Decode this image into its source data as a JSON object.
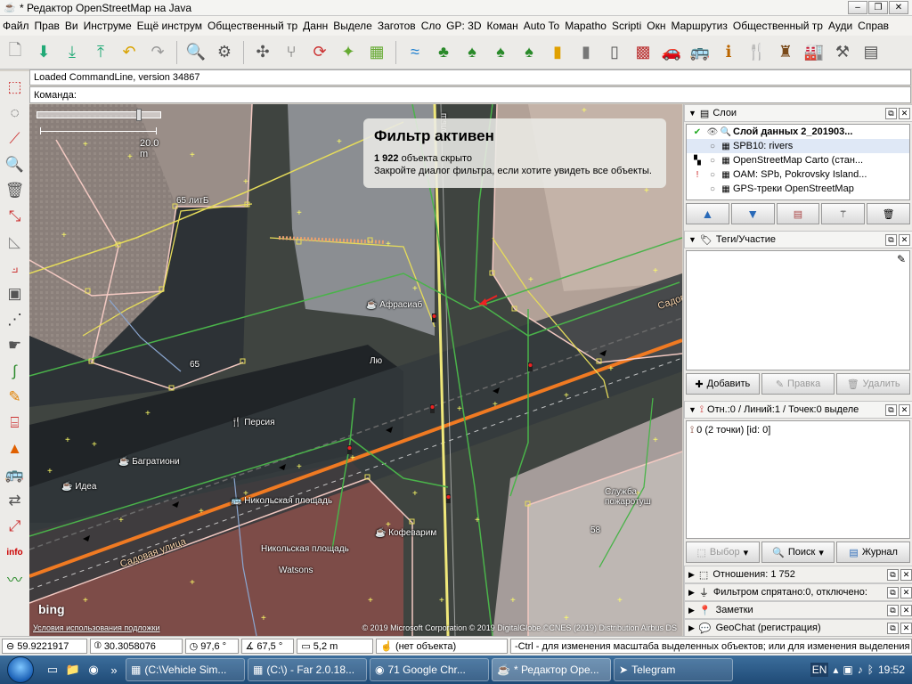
{
  "window": {
    "title": "* Редактор OpenStreetMap на Java"
  },
  "menu": [
    "Файл",
    "Прав",
    "Ви",
    "Инструме",
    "Ещё инструм",
    "Общественный тр",
    "Данн",
    "Выделе",
    "Заготов",
    "Сло",
    "GP: 3D",
    "Коман",
    "Auto To",
    "Mapatho",
    "Scripti",
    "Окн",
    "Маршрутиз",
    "Общественный тр",
    "Ауди",
    "Справ"
  ],
  "info": {
    "loaded": "Loaded CommandLine, version 34867",
    "command": "Команда:"
  },
  "map": {
    "scale": "20.0 m",
    "filter": {
      "title": "Фильтр активен",
      "count": "1 922",
      "count_text": " объекта скрыто",
      "hint": "Закройте диалог фильтра, если хотите увидеть все объекты."
    },
    "labels": {
      "building1": "65 литБ",
      "building2": "65",
      "building3": "58",
      "street1": "Садовая улица",
      "street2": "Садов",
      "street3": "Больш",
      "poi1": "Афрасиаб",
      "poi2": "Персия",
      "poi3": "Багратиони",
      "poi4": "Идеа",
      "poi5": "Никольская площадь",
      "poi6": "Никольская площадь",
      "poi7": "Watsons",
      "poi8": "Кофеварим",
      "poi9": "Служба пожаротуш",
      "poi10": "Лю"
    },
    "bing": "bing",
    "terms": "Условия использования подложки",
    "attribution": "© 2019 Microsoft Corporation © 2019 DigitalGlobe ©CNES (2019) Distribution Airbus DS"
  },
  "layers": {
    "title": "Слои",
    "rows": [
      {
        "name": "Слой данных 2_201903...",
        "bold": true
      },
      {
        "name": "SPB10: rivers",
        "bold": false
      },
      {
        "name": "OpenStreetMap Carto (стан...",
        "bold": false
      },
      {
        "name": "OAM: SPb, Pokrovsky Island...",
        "bold": false
      },
      {
        "name": "GPS-треки OpenStreetMap",
        "bold": false
      }
    ]
  },
  "tags": {
    "title": "Теги/Участие",
    "add": "Добавить",
    "edit": "Правка",
    "delete": "Удалить"
  },
  "relations": {
    "title": "Отн.:0 / Линий:1 / Точек:0 выделе",
    "item": "0 (2 точки) [id: 0]",
    "select": "Выбор",
    "search": "Поиск",
    "history": "Журнал"
  },
  "collapsed": [
    "Отношения: 1 752",
    "Фильтром спрятано:0, отключено:",
    "Заметки",
    "GeoChat (регистрация)"
  ],
  "status": {
    "lat": "59.9221917",
    "lon": "30.3058076",
    "heading": "97,6 °",
    "angle": "67,5 °",
    "distance": "5,2 m",
    "object": "(нет объекта)",
    "hint": "-Ctrl - для изменения масштаба выделенных объектов; или для изменения выделения"
  },
  "taskbar": {
    "tasks": [
      {
        "label": "(C:\\Vehicle Sim..."
      },
      {
        "label": "(C:\\) - Far 2.0.18..."
      },
      {
        "label": "71 Google Chr..."
      },
      {
        "label": "* Редактор Ope..."
      },
      {
        "label": "Telegram"
      }
    ],
    "lang": "EN",
    "time": "19:52"
  }
}
